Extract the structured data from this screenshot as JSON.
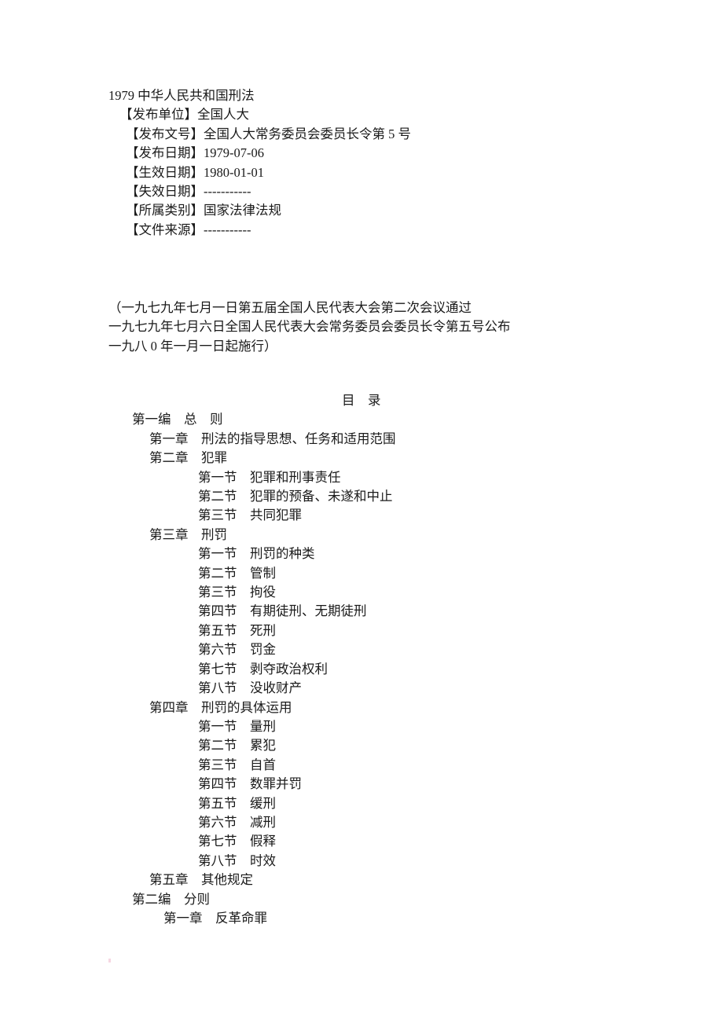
{
  "document": {
    "title": "1979 中华人民共和国刑法",
    "metadata": [
      {
        "label": "【发布单位】",
        "value": "全国人大",
        "indent": "lvl1"
      },
      {
        "label": "【发布文号】",
        "value": "全国人大常务委员会委员长令第 5 号",
        "indent": "lvl2"
      },
      {
        "label": "【发布日期】",
        "value": "1979-07-06",
        "indent": "lvl2"
      },
      {
        "label": "【生效日期】",
        "value": "1980-01-01",
        "indent": "lvl2"
      },
      {
        "label": "【失效日期】",
        "value": "-----------",
        "indent": "lvl2"
      },
      {
        "label": "【所属类别】",
        "value": "国家法律法规",
        "indent": "lvl2"
      },
      {
        "label": "【文件来源】",
        "value": "-----------",
        "indent": "lvl2"
      }
    ],
    "metadata_lines": [
      "1979 中华人民共和国刑法",
      "【发布单位】全国人大",
      "【发布文号】全国人大常务委员会委员长令第 5 号",
      "【发布日期】1979-07-06",
      "【生效日期】1980-01-01",
      "【失效日期】-----------",
      "【所属类别】国家法律法规",
      "【文件来源】-----------"
    ],
    "promulgation": [
      "（一九七九年七月一日第五届全国人民代表大会第二次会议通过",
      "一九七九年七月六日全国人民代表大会常务委员会委员长令第五号公布",
      "一九八 0 年一月一日起施行）"
    ],
    "toc": {
      "heading": "目　录",
      "entries": [
        {
          "level": "part",
          "text": "第一编　总　则"
        },
        {
          "level": "chapter",
          "text": "第一章　刑法的指导思想、任务和适用范围"
        },
        {
          "level": "chapter",
          "text": "第二章　犯罪"
        },
        {
          "level": "section",
          "text": "第一节　犯罪和刑事责任"
        },
        {
          "level": "section",
          "text": "第二节　犯罪的预备、未遂和中止"
        },
        {
          "level": "section",
          "text": "第三节　共同犯罪"
        },
        {
          "level": "chapter",
          "text": "第三章　刑罚"
        },
        {
          "level": "section",
          "text": "第一节　刑罚的种类"
        },
        {
          "level": "section",
          "text": "第二节　管制"
        },
        {
          "level": "section",
          "text": "第三节　拘役"
        },
        {
          "level": "section",
          "text": "第四节　有期徒刑、无期徒刑"
        },
        {
          "level": "section",
          "text": "第五节　死刑"
        },
        {
          "level": "section",
          "text": "第六节　罚金"
        },
        {
          "level": "section",
          "text": "第七节　剥夺政治权利"
        },
        {
          "level": "section",
          "text": "第八节　没收财产"
        },
        {
          "level": "chapter",
          "text": "第四章　刑罚的具体运用"
        },
        {
          "level": "section",
          "text": "第一节　量刑"
        },
        {
          "level": "section",
          "text": "第二节　累犯"
        },
        {
          "level": "section",
          "text": "第三节　自首"
        },
        {
          "level": "section",
          "text": "第四节　数罪并罚"
        },
        {
          "level": "section",
          "text": "第五节　缓刑"
        },
        {
          "level": "section",
          "text": "第六节　减刑"
        },
        {
          "level": "section",
          "text": "第七节　假释"
        },
        {
          "level": "section",
          "text": "第八节　时效"
        },
        {
          "level": "chapter",
          "text": "第五章　其他规定"
        },
        {
          "level": "part",
          "text": "第二编　分则"
        },
        {
          "level": "chapter-deep",
          "text": "第一章　反革命罪"
        }
      ]
    }
  },
  "colors": {
    "page_background": "#ffffff",
    "text": "#1a1a1a"
  }
}
